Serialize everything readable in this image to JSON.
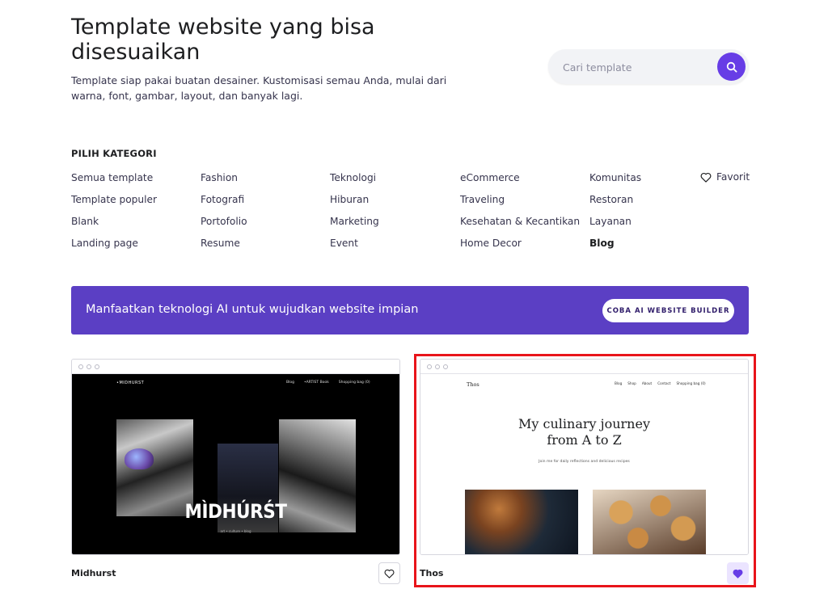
{
  "hero": {
    "title": "Template website yang bisa disesuaikan",
    "description": "Template siap pakai buatan desainer. Kustomisasi semau Anda, mulai dari warna, font, gambar, layout, dan banyak lagi."
  },
  "search": {
    "placeholder": "Cari template",
    "icon": "search-icon"
  },
  "categories": {
    "heading": "PILIH KATEGORI",
    "columns": [
      [
        "Semua template",
        "Template populer",
        "Blank",
        "Landing page"
      ],
      [
        "Fashion",
        "Fotografi",
        "Portofolio",
        "Resume"
      ],
      [
        "Teknologi",
        "Hiburan",
        "Marketing",
        "Event"
      ],
      [
        "eCommerce",
        "Traveling",
        "Kesehatan & Kecantikan",
        "Home Decor"
      ],
      [
        "Komunitas",
        "Restoran",
        "Layanan",
        "Blog"
      ]
    ],
    "active": "Blog",
    "favorite_label": "Favorit"
  },
  "banner": {
    "text": "Manfaatkan teknologi AI untuk wujudkan website impian",
    "button": "COBA AI WEBSITE BUILDER",
    "color": "#5b3fc4"
  },
  "templates": [
    {
      "name": "Midhurst",
      "favorited": false,
      "preview": {
        "logo": "•MIDHURST",
        "nav": [
          "Blog",
          "•ARTIST Book",
          "Shopping bag (0)"
        ],
        "headline": "MÌDHÚRŚT",
        "sub": "art • culture • blog"
      }
    },
    {
      "name": "Thos",
      "favorited": true,
      "preview": {
        "logo": "Thos",
        "nav": [
          "Blog",
          "Shop",
          "About",
          "Contact",
          "Shopping bag (0)"
        ],
        "headline_line1": "My culinary journey",
        "headline_line2": "from A to Z",
        "sub": "Join me for daily reflections and delicious recipes"
      }
    }
  ],
  "colors": {
    "accent": "#673de6",
    "highlight": "#e8141a"
  }
}
